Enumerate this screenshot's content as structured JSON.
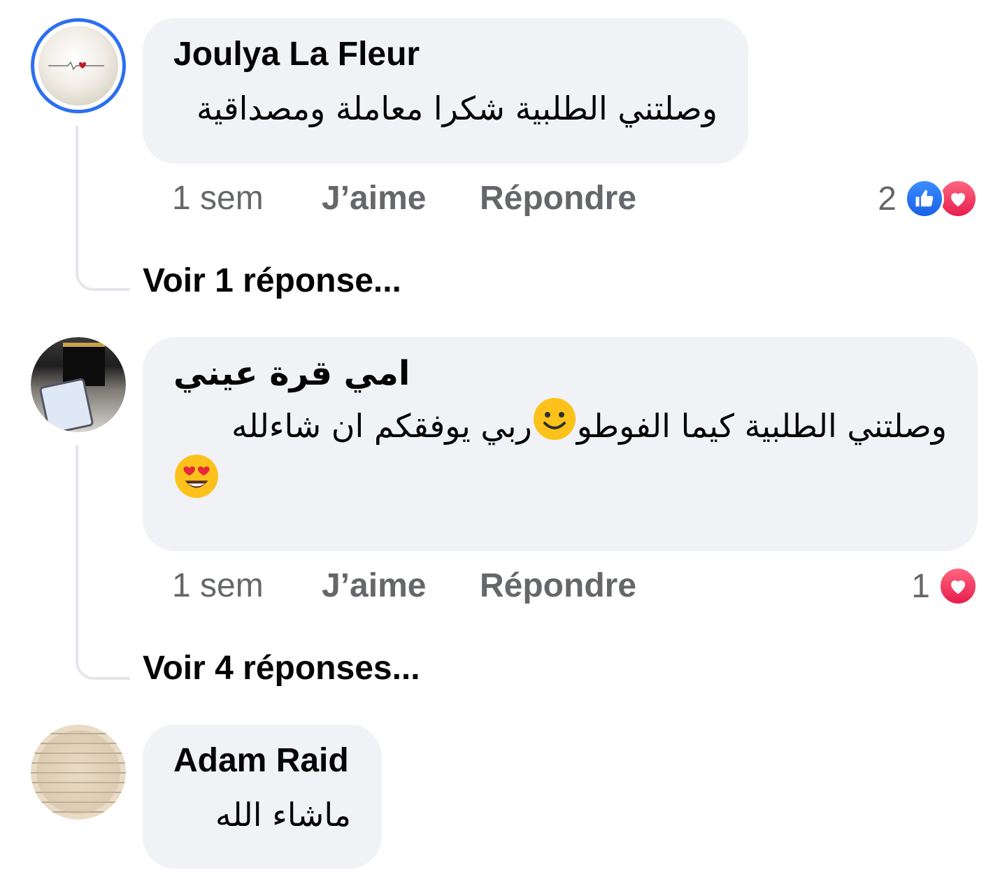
{
  "comments": [
    {
      "author": "Joulya La Fleur",
      "text": "وصلتني الطلبية شكرا معاملة ومصداقية",
      "time": "1 sem",
      "like_label": "J’aime",
      "reply_label": "Répondre",
      "reaction_count": "2",
      "reactions": [
        "like-icon",
        "love-icon"
      ],
      "view_replies": "Voir 1 réponse..."
    },
    {
      "author": "امي قرة عيني",
      "text_line1_part1": "ربي يوفقكم ان شاءلله",
      "text_line1_part2": "وصلتني الطلبية كيما الفوطو",
      "emoji1": "slightly-smiling-face-emoji",
      "emoji2": "heart-eyes-emoji",
      "time": "1 sem",
      "like_label": "J’aime",
      "reply_label": "Répondre",
      "reaction_count": "1",
      "reactions": [
        "love-icon"
      ],
      "view_replies": "Voir 4 réponses..."
    },
    {
      "author": "Adam Raid",
      "text": "ماشاء الله"
    }
  ],
  "colors": {
    "story_ring": "#2d6ff0",
    "bubble_bg": "#f0f2f5",
    "muted_text": "#65676b",
    "like_blue": "#1877f2",
    "love_red": "#f33e58"
  }
}
